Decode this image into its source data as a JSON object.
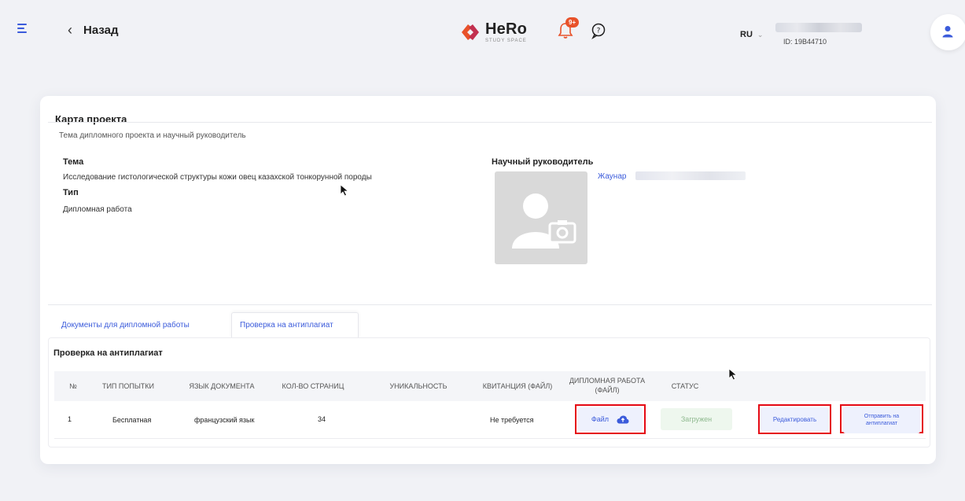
{
  "header": {
    "back_label": "Назад",
    "logo_name": "HeRo",
    "logo_sub": "STUDY SPACE",
    "notif_badge": "9+",
    "lang": "RU",
    "user_id": "ID: 19B44710"
  },
  "card": {
    "title": "Карта проекта",
    "section_subtitle": "Тема дипломного проекта и научный руководитель",
    "topic_label": "Тема",
    "topic_value": "Исследование гистологической структуры кожи овец казахской тонкорунной породы",
    "type_label": "Тип",
    "type_value": "Дипломная работа",
    "supervisor_label": "Научный руководитель",
    "supervisor_name": "Жаунар"
  },
  "tabs": [
    {
      "label": "Документы для дипломной работы",
      "active": false
    },
    {
      "label": "Проверка на антиплагиат",
      "active": true
    }
  ],
  "plagiarism": {
    "title": "Проверка на антиплагиат",
    "columns": [
      "№",
      "Тип попытки",
      "Язык документа",
      "Кол-во страниц",
      "Уникальность",
      "Квитанция (файл)",
      "Дипломная работа (файл)",
      "Статус"
    ],
    "rows": [
      {
        "num": "1",
        "attempt_type": "Бесплатная",
        "language": "французский язык",
        "pages": "34",
        "uniqueness": "",
        "receipt": "Не требуется",
        "file_label": "Файл",
        "status": "Загружен",
        "edit_label": "Редактировать",
        "send_label": "Отправить на антиплагиат"
      }
    ]
  },
  "colors": {
    "accent": "#3b5bdb",
    "highlight": "#e50914",
    "badge": "#e8522a"
  }
}
